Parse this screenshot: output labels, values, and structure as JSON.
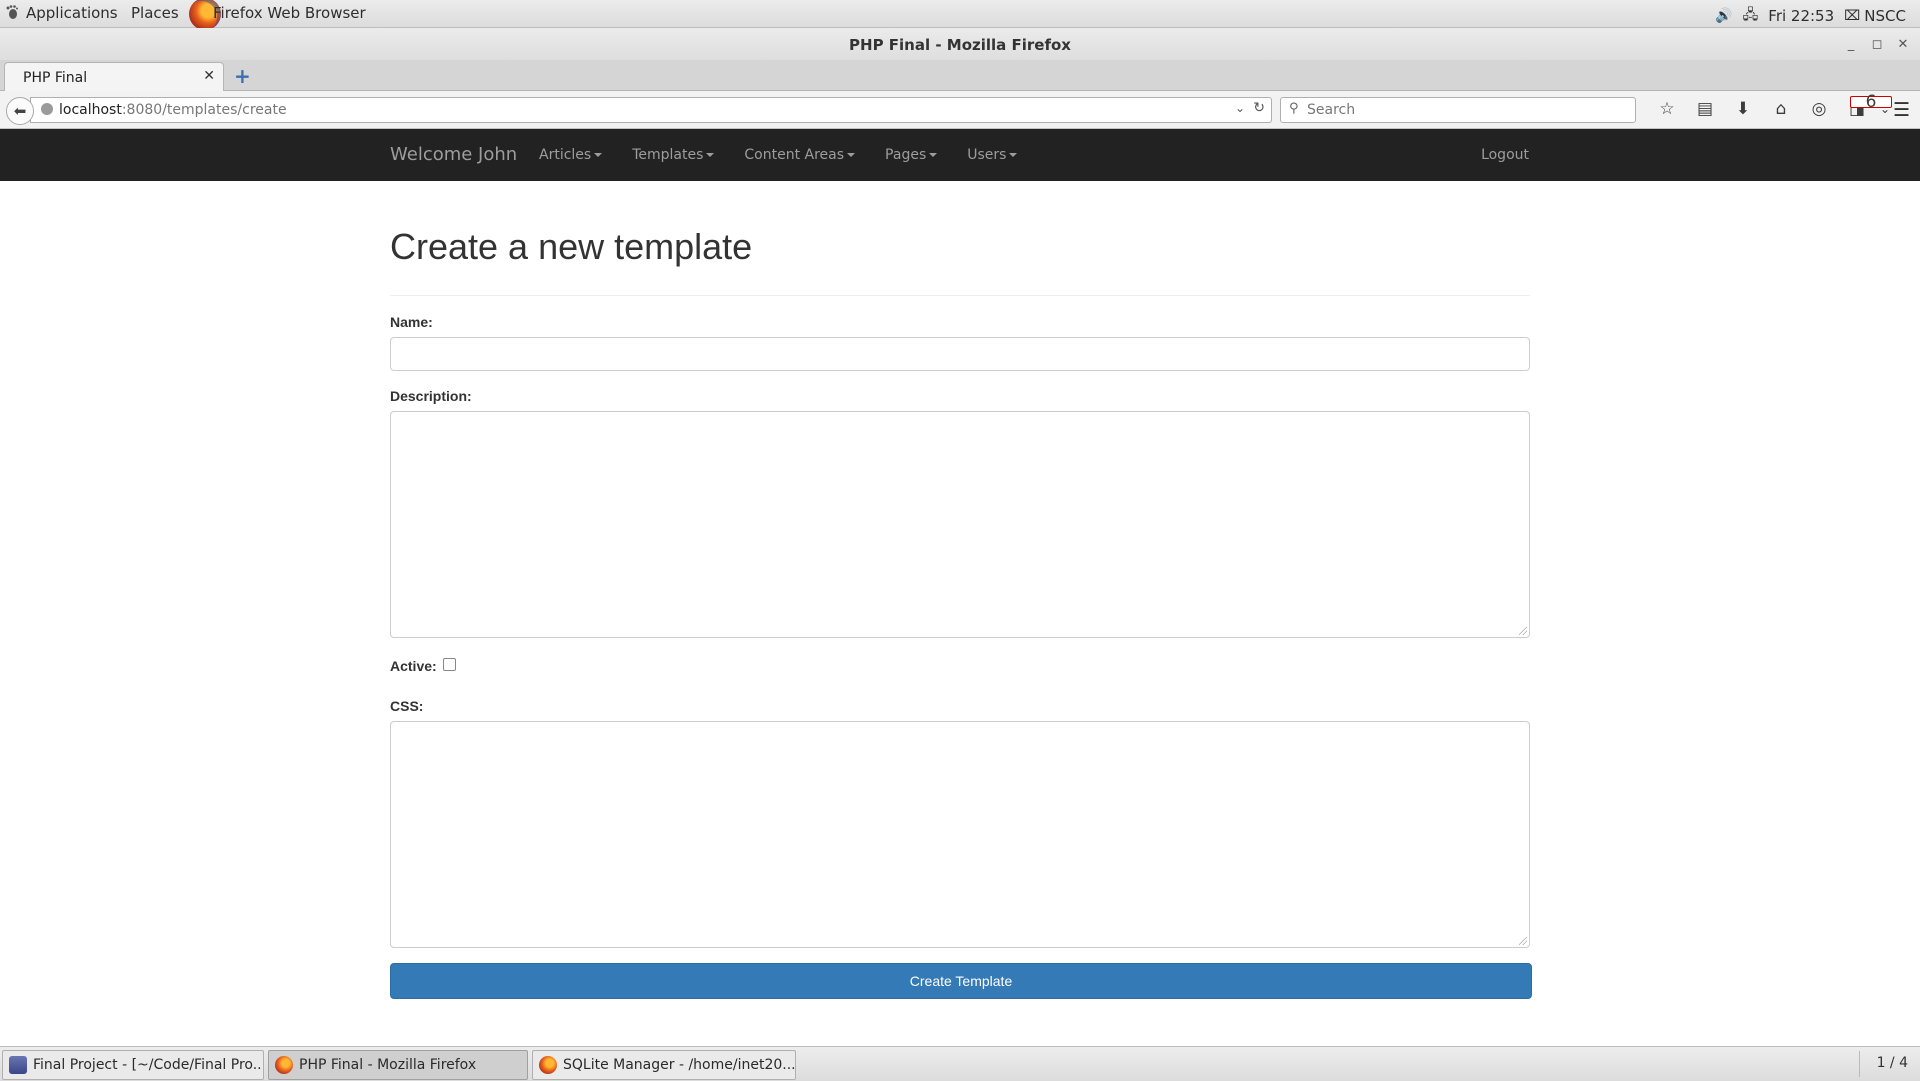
{
  "top_panel": {
    "applications": "Applications",
    "places": "Places",
    "active_app": "Firefox Web Browser",
    "clock": "Fri 22:53",
    "user": "NSCC",
    "icons": [
      "volume-icon",
      "network-icon",
      "user-icon"
    ]
  },
  "window": {
    "title": "PHP Final - Mozilla Firefox"
  },
  "tabs": [
    {
      "label": "PHP Final",
      "active": true
    }
  ],
  "toolbar": {
    "url_host": "localhost",
    "url_rest": ":8080/templates/create",
    "search_placeholder": "Search",
    "badge_count": "6",
    "icons": [
      "star-icon",
      "reading-list-icon",
      "download-icon",
      "home-icon",
      "pocket-icon",
      "extension-icon",
      "menu-icon"
    ]
  },
  "site_nav": {
    "brand": "Welcome John",
    "menu": [
      {
        "label": "Articles"
      },
      {
        "label": "Templates"
      },
      {
        "label": "Content Areas"
      },
      {
        "label": "Pages"
      },
      {
        "label": "Users"
      }
    ],
    "logout": "Logout"
  },
  "form": {
    "title": "Create a new template",
    "name_label": "Name:",
    "name_value": "",
    "description_label": "Description:",
    "description_value": "",
    "active_label": "Active:",
    "active_checked": false,
    "css_label": "CSS:",
    "css_value": "",
    "submit_label": "Create Template"
  },
  "taskbar": {
    "tasks": [
      {
        "label": "Final Project - [~/Code/Final Pro...",
        "icon": "phpstorm-icon",
        "active": false
      },
      {
        "label": "PHP Final - Mozilla Firefox",
        "icon": "firefox-icon",
        "active": true
      },
      {
        "label": "SQLite Manager - /home/inet20...",
        "icon": "firefox-icon",
        "active": false
      }
    ],
    "workspace": "1 / 4"
  },
  "colors": {
    "site_nav_bg": "#222222",
    "primary_button": "#337ab7"
  }
}
